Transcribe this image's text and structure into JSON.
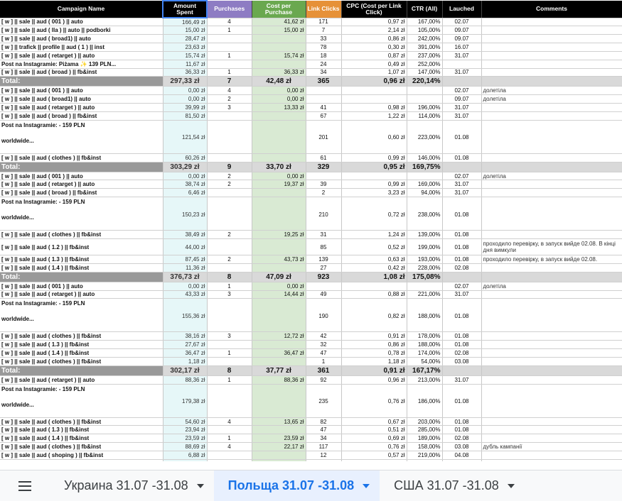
{
  "headers": {
    "name": "Campaign Name",
    "amount": "Amount Spent",
    "purchases": "Purchases",
    "cpp": "Cost per Purchase",
    "link_clicks": "Link Clicks",
    "cpc": "CPC (Cost per Link Click)",
    "ctr": "CTR (All)",
    "launched": "Lauched",
    "comments": "Comments"
  },
  "rows": [
    {
      "type": "row",
      "name": "[ w ] || sale || aud ( 001 ) || auto",
      "amount": "166,49 zł",
      "purchases": "4",
      "cpp": "41,62 zł",
      "link_clicks": "171",
      "cpc": "0,97 zł",
      "ctr": "167,00%",
      "launched": "02.07",
      "comment": ""
    },
    {
      "type": "row",
      "name": "[ w ] || sale || aud ( lla ) || auto || podborki",
      "amount": "15,00 zł",
      "purchases": "1",
      "cpp": "15,00 zł",
      "link_clicks": "7",
      "cpc": "2,14 zł",
      "ctr": "105,00%",
      "launched": "09.07",
      "comment": ""
    },
    {
      "type": "row",
      "name": "[ w ] || sale || aud ( broad1) || auto",
      "amount": "28,47 zł",
      "purchases": "",
      "cpp": "",
      "link_clicks": "33",
      "cpc": "0,86 zł",
      "ctr": "242,00%",
      "launched": "09.07",
      "comment": ""
    },
    {
      "type": "row",
      "name": "[ w ] || trafick || profile || aud ( 1 ) || inst",
      "amount": "23,63 zł",
      "purchases": "",
      "cpp": "",
      "link_clicks": "78",
      "cpc": "0,30 zł",
      "ctr": "391,00%",
      "launched": "16.07",
      "comment": ""
    },
    {
      "type": "row",
      "name": "[ w ] || sale || aud ( retarget ) || auto",
      "amount": "15,74 zł",
      "purchases": "1",
      "cpp": "15,74 zł",
      "link_clicks": "18",
      "cpc": "0,87 zł",
      "ctr": "237,00%",
      "launched": "31.07",
      "comment": ""
    },
    {
      "type": "row",
      "name": "Post na Instagramie: Piżama ✨ 139 PLN...",
      "amount": "11,67 zł",
      "purchases": "",
      "cpp": "",
      "link_clicks": "24",
      "cpc": "0,49 zł",
      "ctr": "252,00%",
      "launched": "",
      "comment": ""
    },
    {
      "type": "row",
      "name": "[ w ] || sale || aud ( broad ) || fb&inst",
      "amount": "36,33 zł",
      "purchases": "1",
      "cpp": "36,33 zł",
      "link_clicks": "34",
      "cpc": "1,07 zł",
      "ctr": "147,00%",
      "launched": "31.07",
      "comment": ""
    },
    {
      "type": "total",
      "name": "Total:",
      "amount": "297,33 zł",
      "purchases": "7",
      "cpp": "42,48 zł",
      "link_clicks": "365",
      "cpc": "0,96 zł",
      "ctr": "220,14%",
      "launched": "",
      "comment": ""
    },
    {
      "type": "row",
      "name": "[ w ] || sale || aud ( 001 ) || auto",
      "amount": "0,00 zł",
      "purchases": "4",
      "cpp": "0,00 zł",
      "link_clicks": "",
      "cpc": "",
      "ctr": "",
      "launched": "02.07",
      "comment": "долетіла"
    },
    {
      "type": "row",
      "name": "[ w ] || sale || aud ( broad1) || auto",
      "amount": "0,00 zł",
      "purchases": "2",
      "cpp": "0,00 zł",
      "link_clicks": "",
      "cpc": "",
      "ctr": "",
      "launched": "09.07",
      "comment": "долетіла"
    },
    {
      "type": "row",
      "name": "[ w ] || sale || aud ( retarget ) || auto",
      "amount": "39,99 zł",
      "purchases": "3",
      "cpp": "13,33 zł",
      "link_clicks": "41",
      "cpc": "0,98 zł",
      "ctr": "196,00%",
      "launched": "31.07",
      "comment": ""
    },
    {
      "type": "row",
      "name": "[ w ] || sale || aud ( broad ) || fb&inst",
      "amount": "81,50 zł",
      "purchases": "",
      "cpp": "",
      "link_clicks": "67",
      "cpc": "1,22 zł",
      "ctr": "114,00%",
      "launched": "31.07",
      "comment": ""
    },
    {
      "type": "tall",
      "name": "Post na Instagramie: - 159 PLN",
      "name2": "worldwide...",
      "amount": "121,54 zł",
      "purchases": "",
      "cpp": "",
      "link_clicks": "201",
      "cpc": "0,60 zł",
      "ctr": "223,00%",
      "launched": "01.08",
      "comment": ""
    },
    {
      "type": "row",
      "name": "[ w ] || sale || aud ( clothes ) || fb&inst",
      "amount": "60,26 zł",
      "purchases": "",
      "cpp": "",
      "link_clicks": "61",
      "cpc": "0,99 zł",
      "ctr": "146,00%",
      "launched": "01.08",
      "comment": ""
    },
    {
      "type": "total",
      "name": "Total:",
      "amount": "303,29 zł",
      "purchases": "9",
      "cpp": "33,70 zł",
      "link_clicks": "329",
      "cpc": "0,95 zł",
      "ctr": "169,75%",
      "launched": "",
      "comment": ""
    },
    {
      "type": "row",
      "name": "[ w ] || sale || aud ( 001 ) || auto",
      "amount": "0,00 zł",
      "purchases": "2",
      "cpp": "0,00 zł",
      "link_clicks": "",
      "cpc": "",
      "ctr": "",
      "launched": "02.07",
      "comment": "долетіла"
    },
    {
      "type": "row",
      "name": "[ w ] || sale || aud ( retarget ) || auto",
      "amount": "38,74 zł",
      "purchases": "2",
      "cpp": "19,37 zł",
      "link_clicks": "39",
      "cpc": "0,99 zł",
      "ctr": "169,00%",
      "launched": "31.07",
      "comment": ""
    },
    {
      "type": "row",
      "name": "[ w ] || sale || aud ( broad ) || fb&inst",
      "amount": "6,46 zł",
      "purchases": "",
      "cpp": "",
      "link_clicks": "2",
      "cpc": "3,23 zł",
      "ctr": "94,00%",
      "launched": "31.07",
      "comment": ""
    },
    {
      "type": "tall",
      "name": "Post na Instagramie: - 159 PLN",
      "name2": "worldwide...",
      "amount": "150,23 zł",
      "purchases": "",
      "cpp": "",
      "link_clicks": "210",
      "cpc": "0,72 zł",
      "ctr": "238,00%",
      "launched": "01.08",
      "comment": ""
    },
    {
      "type": "row",
      "name": "[ w ] || sale || aud ( clothes ) || fb&inst",
      "amount": "38,49 zł",
      "purchases": "2",
      "cpp": "19,25 zł",
      "link_clicks": "31",
      "cpc": "1,24 zł",
      "ctr": "139,00%",
      "launched": "01.08",
      "comment": ""
    },
    {
      "type": "mid",
      "name": "[ w ] || sale || aud ( 1.2 ) || fb&inst",
      "amount": "44,00 zł",
      "purchases": "",
      "cpp": "",
      "link_clicks": "85",
      "cpc": "0,52 zł",
      "ctr": "199,00%",
      "launched": "01.08",
      "comment": "проходило перевірку, в запуск вийде 02.08. В кінці дня вимкули"
    },
    {
      "type": "row",
      "name": "[ w ] || sale || aud ( 1.3 ) || fb&inst",
      "amount": "87,45 zł",
      "purchases": "2",
      "cpp": "43,73 zł",
      "link_clicks": "139",
      "cpc": "0,63 zł",
      "ctr": "193,00%",
      "launched": "01.08",
      "comment": "проходило перевірку, в запуск вийде 02.08."
    },
    {
      "type": "row",
      "name": "[ w ] || sale || aud ( 1.4 ) || fb&inst",
      "amount": "11,36 zł",
      "purchases": "",
      "cpp": "",
      "link_clicks": "27",
      "cpc": "0,42 zł",
      "ctr": "228,00%",
      "launched": "02.08",
      "comment": ""
    },
    {
      "type": "total",
      "name": "Total:",
      "amount": "376,73 zł",
      "purchases": "8",
      "cpp": "47,09 zł",
      "link_clicks": "923",
      "cpc": "1,08 zł",
      "ctr": "175,08%",
      "launched": "",
      "comment": ""
    },
    {
      "type": "row",
      "name": "[ w ] || sale || aud ( 001 ) || auto",
      "amount": "0,00 zł",
      "purchases": "1",
      "cpp": "0,00 zł",
      "link_clicks": "",
      "cpc": "",
      "ctr": "",
      "launched": "02.07",
      "comment": "долетіла"
    },
    {
      "type": "row",
      "name": "[ w ] || sale || aud ( retarget ) || auto",
      "amount": "43,33 zł",
      "purchases": "3",
      "cpp": "14,44 zł",
      "link_clicks": "49",
      "cpc": "0,88 zł",
      "ctr": "221,00%",
      "launched": "31.07",
      "comment": ""
    },
    {
      "type": "tall",
      "name": "Post na Instagramie: - 159 PLN",
      "name2": "worldwide...",
      "amount": "155,36 zł",
      "purchases": "",
      "cpp": "",
      "link_clicks": "190",
      "cpc": "0,82 zł",
      "ctr": "188,00%",
      "launched": "01.08",
      "comment": ""
    },
    {
      "type": "row",
      "name": "[ w ] || sale || aud ( clothes ) || fb&inst",
      "amount": "38,16 zł",
      "purchases": "3",
      "cpp": "12,72 zł",
      "link_clicks": "42",
      "cpc": "0,91 zł",
      "ctr": "178,00%",
      "launched": "01.08",
      "comment": ""
    },
    {
      "type": "row",
      "name": "[ w ] || sale || aud ( 1.3 ) || fb&inst",
      "amount": "27,67 zł",
      "purchases": "",
      "cpp": "",
      "link_clicks": "32",
      "cpc": "0,86 zł",
      "ctr": "188,00%",
      "launched": "01.08",
      "comment": ""
    },
    {
      "type": "row",
      "name": "[ w ] || sale || aud ( 1.4 ) || fb&inst",
      "amount": "36,47 zł",
      "purchases": "1",
      "cpp": "36,47 zł",
      "link_clicks": "47",
      "cpc": "0,78 zł",
      "ctr": "174,00%",
      "launched": "02.08",
      "comment": ""
    },
    {
      "type": "row",
      "name": "[ w ] || sale || aud ( clothes ) || fb&inst",
      "amount": "1,18 zł",
      "purchases": "",
      "cpp": "",
      "link_clicks": "1",
      "cpc": "1,18 zł",
      "ctr": "54,00%",
      "launched": "03.08",
      "comment": ""
    },
    {
      "type": "total",
      "name": "Total:",
      "amount": "302,17 zł",
      "purchases": "8",
      "cpp": "37,77 zł",
      "link_clicks": "361",
      "cpc": "0,91 zł",
      "ctr": "167,17%",
      "launched": "",
      "comment": ""
    },
    {
      "type": "row",
      "name": "[ w ] || sale || aud ( retarget ) || auto",
      "amount": "88,36 zł",
      "purchases": "1",
      "cpp": "88,36 zł",
      "link_clicks": "92",
      "cpc": "0,96 zł",
      "ctr": "213,00%",
      "launched": "31.07",
      "comment": ""
    },
    {
      "type": "tall",
      "name": "Post na Instagramie: - 159 PLN",
      "name2": "worldwide...",
      "amount": "179,38 zł",
      "purchases": "",
      "cpp": "",
      "link_clicks": "235",
      "cpc": "0,76 zł",
      "ctr": "186,00%",
      "launched": "01.08",
      "comment": ""
    },
    {
      "type": "row",
      "name": "[ w ] || sale || aud ( clothes ) || fb&inst",
      "amount": "54,60 zł",
      "purchases": "4",
      "cpp": "13,65 zł",
      "link_clicks": "82",
      "cpc": "0,67 zł",
      "ctr": "203,00%",
      "launched": "01.08",
      "comment": ""
    },
    {
      "type": "row",
      "name": "[ w ] || sale || aud ( 1.3 ) || fb&inst",
      "amount": "23,94 zł",
      "purchases": "",
      "cpp": "",
      "link_clicks": "47",
      "cpc": "0,51 zł",
      "ctr": "285,00%",
      "launched": "01.08",
      "comment": ""
    },
    {
      "type": "row",
      "name": "[ w ] || sale || aud ( 1.4 ) || fb&inst",
      "amount": "23,59 zł",
      "purchases": "1",
      "cpp": "23,59 zł",
      "link_clicks": "34",
      "cpc": "0,69 zł",
      "ctr": "189,00%",
      "launched": "02.08",
      "comment": ""
    },
    {
      "type": "row",
      "name": "[ w ] || sale || aud ( clothes ) || fb&inst",
      "amount": "88,69 zł",
      "purchases": "4",
      "cpp": "22,17 zł",
      "link_clicks": "117",
      "cpc": "0,76 zł",
      "ctr": "158,00%",
      "launched": "03.08",
      "comment": "дубль кампанії"
    },
    {
      "type": "row",
      "name": "[ w ] || sale || aud ( shoping ) || fb&inst",
      "amount": "6,88 zł",
      "purchases": "",
      "cpp": "",
      "link_clicks": "12",
      "cpc": "0,57 zł",
      "ctr": "219,00%",
      "launched": "04.08",
      "comment": ""
    },
    {
      "type": "partial",
      "name": "",
      "amount": "",
      "purchases": "",
      "cpp": "",
      "link_clicks": "",
      "cpc": "",
      "ctr": "",
      "launched": "",
      "comment": ""
    }
  ],
  "tabs": [
    {
      "label": "Украина 31.07 -31.08",
      "active": false
    },
    {
      "label": "Польща 31.07 -31.08",
      "active": true
    },
    {
      "label": "США 31.07 -31.08",
      "active": false
    }
  ]
}
